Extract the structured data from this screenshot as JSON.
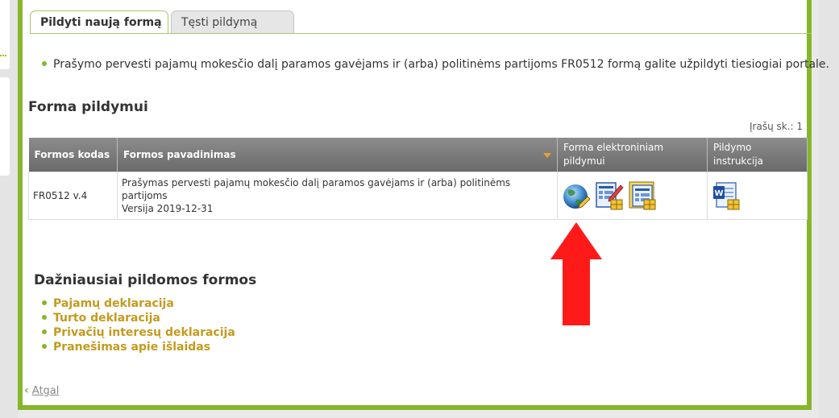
{
  "tabs": [
    {
      "label": "Pildyti naują formą",
      "active": true
    },
    {
      "label": "Tęsti pildymą",
      "active": false
    }
  ],
  "info_text": "Prašymo pervesti pajamų mokesčio dalį paramos gavėjams ir (arba) politinėms partijoms FR0512 formą galite užpildyti tiesiogiai portale.",
  "form_section": {
    "title": "Forma pildymui",
    "records_count": "Įrašų sk.: 1",
    "columns": {
      "code": "Formos kodas",
      "name": "Formos pavadinimas",
      "electronic": "Forma elektroniniam pildymui",
      "instructions": "Pildymo instrukcija"
    },
    "rows": [
      {
        "code": "FR0512 v.4",
        "name": "Prašymas pervesti pajamų mokesčio dalį paramos gavėjams ir (arba) politinėms partijoms",
        "version": "Versija 2019-12-31",
        "electronic_icons": [
          "globe-edit-icon",
          "form-edit-icon",
          "form-grid-icon"
        ],
        "instruction_icons": [
          "word-document-icon"
        ]
      }
    ]
  },
  "frequent": {
    "title": "Dažniausiai pildomos formos",
    "items": [
      "Pajamų deklaracija",
      "Turto deklaracija",
      "Privačių interesų deklaracija",
      "Pranešimas apie išlaidas"
    ]
  },
  "back_label": "Atgal",
  "colors": {
    "accent_green": "#86b62b",
    "link_gold": "#c39a1e",
    "arrow_red": "#ff1a1a",
    "header_gray": "#7a7a7a"
  }
}
